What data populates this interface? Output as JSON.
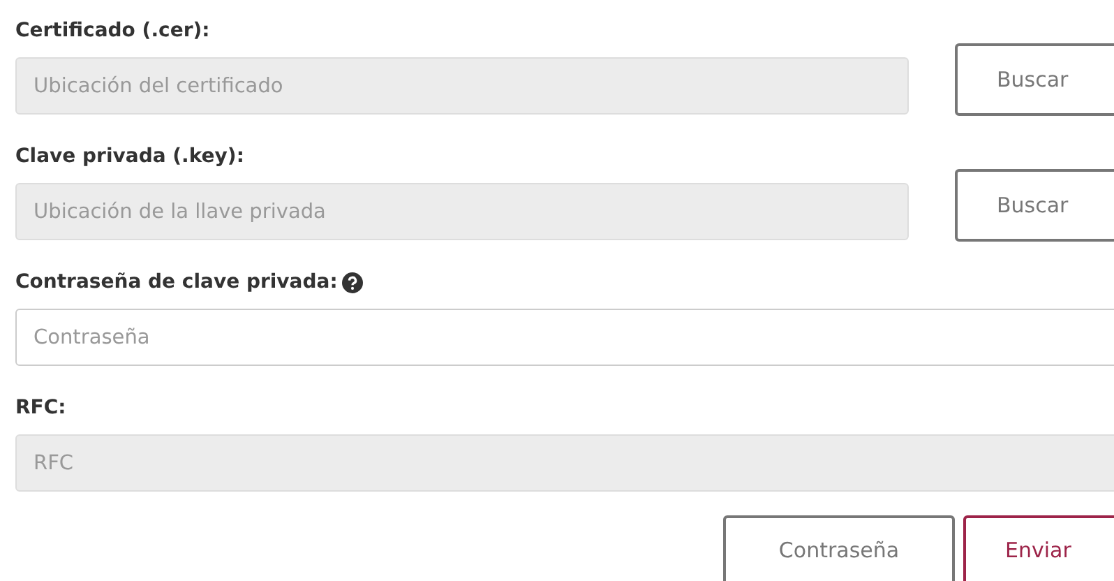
{
  "fields": [
    {
      "label": "Certificado (.cer):",
      "placeholder": "Ubicación del certificado",
      "disabled": true,
      "help": false,
      "button": "Buscar"
    },
    {
      "label": "Clave privada (.key):",
      "placeholder": "Ubicación de la llave privada",
      "disabled": true,
      "help": false,
      "button": "Buscar"
    },
    {
      "label": "Contraseña de clave privada:",
      "placeholder": "Contraseña",
      "disabled": false,
      "help": true
    },
    {
      "label": "RFC:",
      "placeholder": "RFC",
      "disabled": true,
      "help": false
    }
  ],
  "actions": [
    {
      "label": "Contraseña",
      "kind": "secondary"
    },
    {
      "label": "Enviar",
      "kind": "primary"
    }
  ]
}
